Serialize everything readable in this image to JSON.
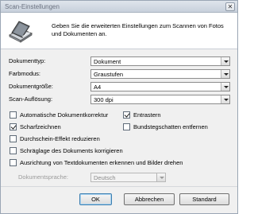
{
  "window": {
    "title": "Scan-Einstellungen",
    "close_label": "✕"
  },
  "header": {
    "icon": "scanner-icon",
    "description": "Geben Sie die erweiterten Einstellungen zum Scannen von Fotos und Dokumenten an."
  },
  "settings": {
    "document_type": {
      "label": "Dokumenttyp:",
      "value": "Dokument"
    },
    "color_mode": {
      "label": "Farbmodus:",
      "value": "Graustufen"
    },
    "document_size": {
      "label": "Dokumentgröße:",
      "value": "A4"
    },
    "scan_resolution": {
      "label": "Scan-Auflösung:",
      "value": "300 dpi"
    }
  },
  "options": {
    "auto_correct": {
      "label": "Automatische Dokumentkorrektur",
      "checked": false
    },
    "descreen": {
      "label": "Entrastern",
      "checked": true
    },
    "sharpen": {
      "label": "Scharfzeichnen",
      "checked": true
    },
    "remove_binding_shadow": {
      "label": "Bundstegschatten entfernen",
      "checked": false
    },
    "reduce_show_through": {
      "label": "Durchschein-Effekt reduzieren",
      "checked": false
    },
    "correct_skew": {
      "label": "Schräglage des Dokuments korrigieren",
      "checked": false
    },
    "text_orientation": {
      "label": "Ausrichtung von Textdokumenten erkennen und Bilder drehen",
      "checked": false
    }
  },
  "document_language": {
    "label": "Dokumentsprache:",
    "value": "Deutsch"
  },
  "buttons": {
    "ok": "OK",
    "cancel": "Abbrechen",
    "default": "Standard"
  }
}
